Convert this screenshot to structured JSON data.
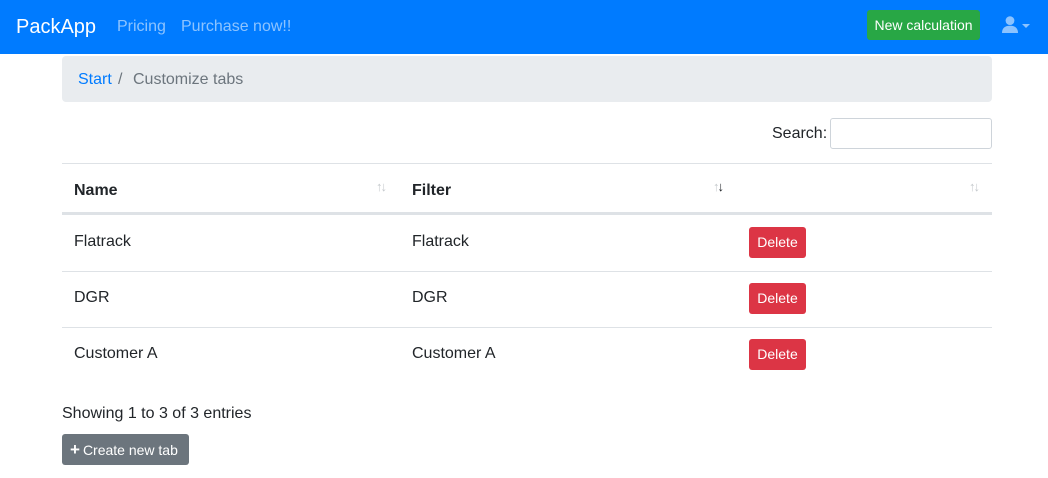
{
  "navbar": {
    "brand": "PackApp",
    "links": [
      {
        "label": "Pricing"
      },
      {
        "label": "Purchase now!!"
      }
    ],
    "new_calculation_label": "New calculation",
    "user_icon": "user-icon",
    "colors": {
      "background": "#007bff",
      "success": "#28a745"
    }
  },
  "breadcrumb": {
    "start": "Start",
    "separator": "/",
    "current": "Customize tabs"
  },
  "search": {
    "label": "Search:",
    "value": ""
  },
  "table": {
    "columns": [
      {
        "label": "Name",
        "sort": "none"
      },
      {
        "label": "Filter",
        "sort": "descending"
      },
      {
        "label": "",
        "sort": "none"
      }
    ],
    "rows": [
      {
        "name": "Flatrack",
        "filter": "Flatrack",
        "action": "Delete"
      },
      {
        "name": "DGR",
        "filter": "DGR",
        "action": "Delete"
      },
      {
        "name": "Customer A",
        "filter": "Customer A",
        "action": "Delete"
      }
    ],
    "colors": {
      "danger": "#dc3545"
    }
  },
  "info": "Showing 1 to 3 of 3 entries",
  "create_button": {
    "icon": "plus-icon",
    "label": "Create new tab"
  }
}
